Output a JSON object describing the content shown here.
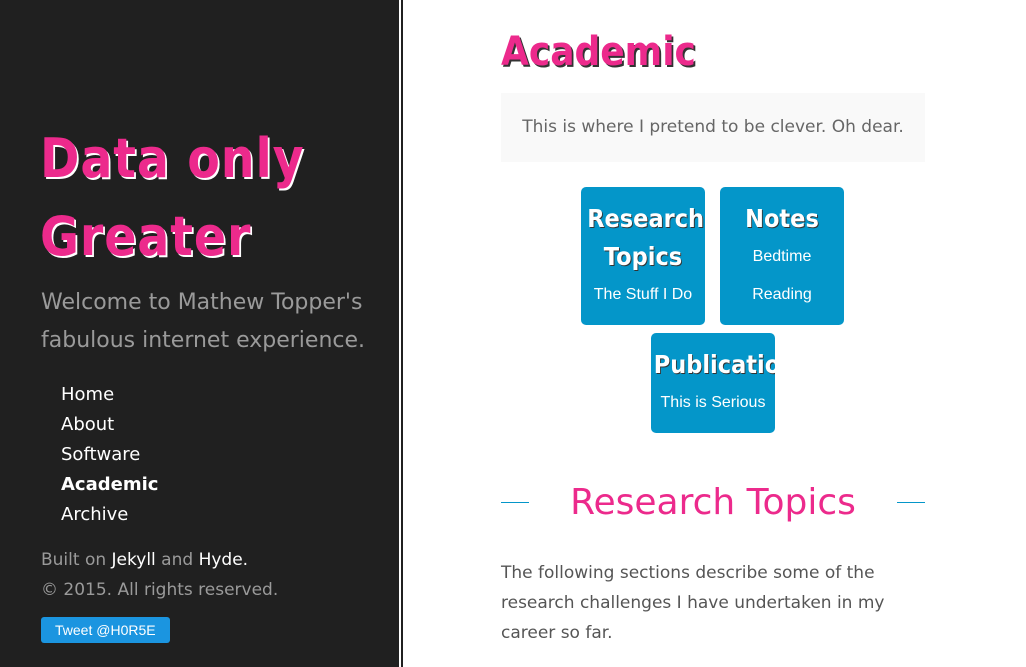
{
  "sidebar": {
    "site_title_line1": "Data only",
    "site_title_line2": "Greater",
    "tagline": "Welcome to Mathew Topper's fabulous internet experience.",
    "nav": [
      {
        "label": "Home"
      },
      {
        "label": "About"
      },
      {
        "label": "Software"
      },
      {
        "label": "Academic"
      },
      {
        "label": "Archive"
      }
    ],
    "built_prefix": "Built on",
    "jekyll": "Jekyll",
    "and": "and",
    "hyde": "Hyde.",
    "copyright": "© 2015. All rights reserved.",
    "tweet_label": "Tweet @H0R5E"
  },
  "main": {
    "page_title": "Academic",
    "lead": "This is where I pretend to be clever. Oh dear.",
    "cards": [
      {
        "title_line1": "Research",
        "title_line2": "Topics",
        "subtitle": "The Stuff I Do"
      },
      {
        "title_line1": "Notes",
        "subtitle_line1": "Bedtime",
        "subtitle_line2": "Reading"
      },
      {
        "title_line1": "Publications",
        "subtitle": "This is Serious"
      }
    ],
    "section_heading": "Research Topics",
    "section_body": "The following sections describe some of the research challenges I have undertaken in my career so far."
  },
  "colors": {
    "accent_pink": "#ec2a8c",
    "card_blue": "#0496c9",
    "sidebar_bg": "#202020",
    "tweet_blue": "#1b95e0"
  }
}
